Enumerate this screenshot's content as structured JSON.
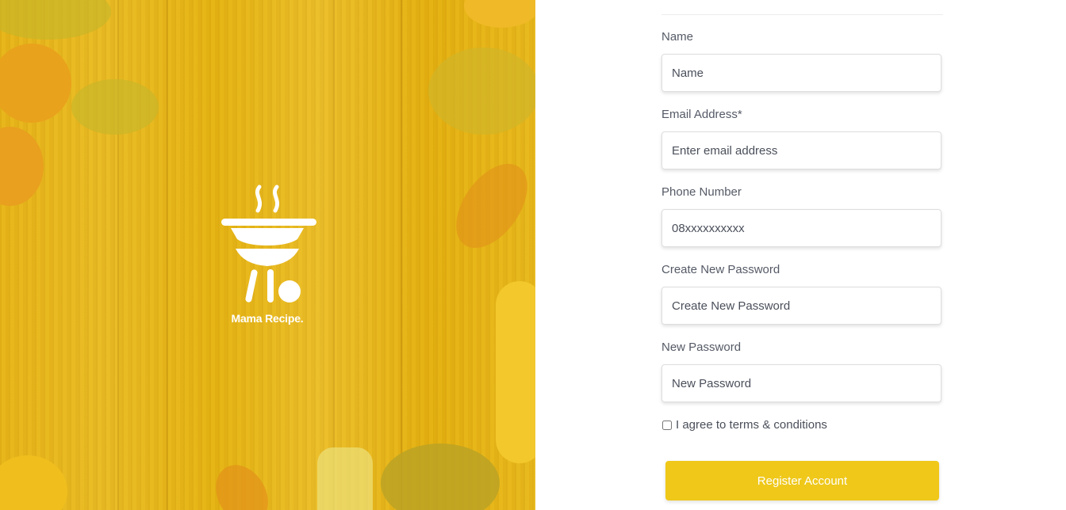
{
  "brand": {
    "name": "Mama Recipe.",
    "logo_icon": "grill-icon"
  },
  "colors": {
    "accent": "#efc81a",
    "hero_overlay": "#e8b81c"
  },
  "form": {
    "fields": [
      {
        "label": "Name",
        "placeholder": "Name",
        "value": ""
      },
      {
        "label": "Email Address*",
        "placeholder": "Enter email address",
        "value": ""
      },
      {
        "label": "Phone Number",
        "placeholder": "08xxxxxxxxxx",
        "value": ""
      },
      {
        "label": "Create New Password",
        "placeholder": "Create New Password",
        "value": ""
      },
      {
        "label": "New Password",
        "placeholder": "New Password",
        "value": ""
      }
    ],
    "terms_label": "I agree to terms & conditions",
    "submit_label": "Register Account"
  }
}
